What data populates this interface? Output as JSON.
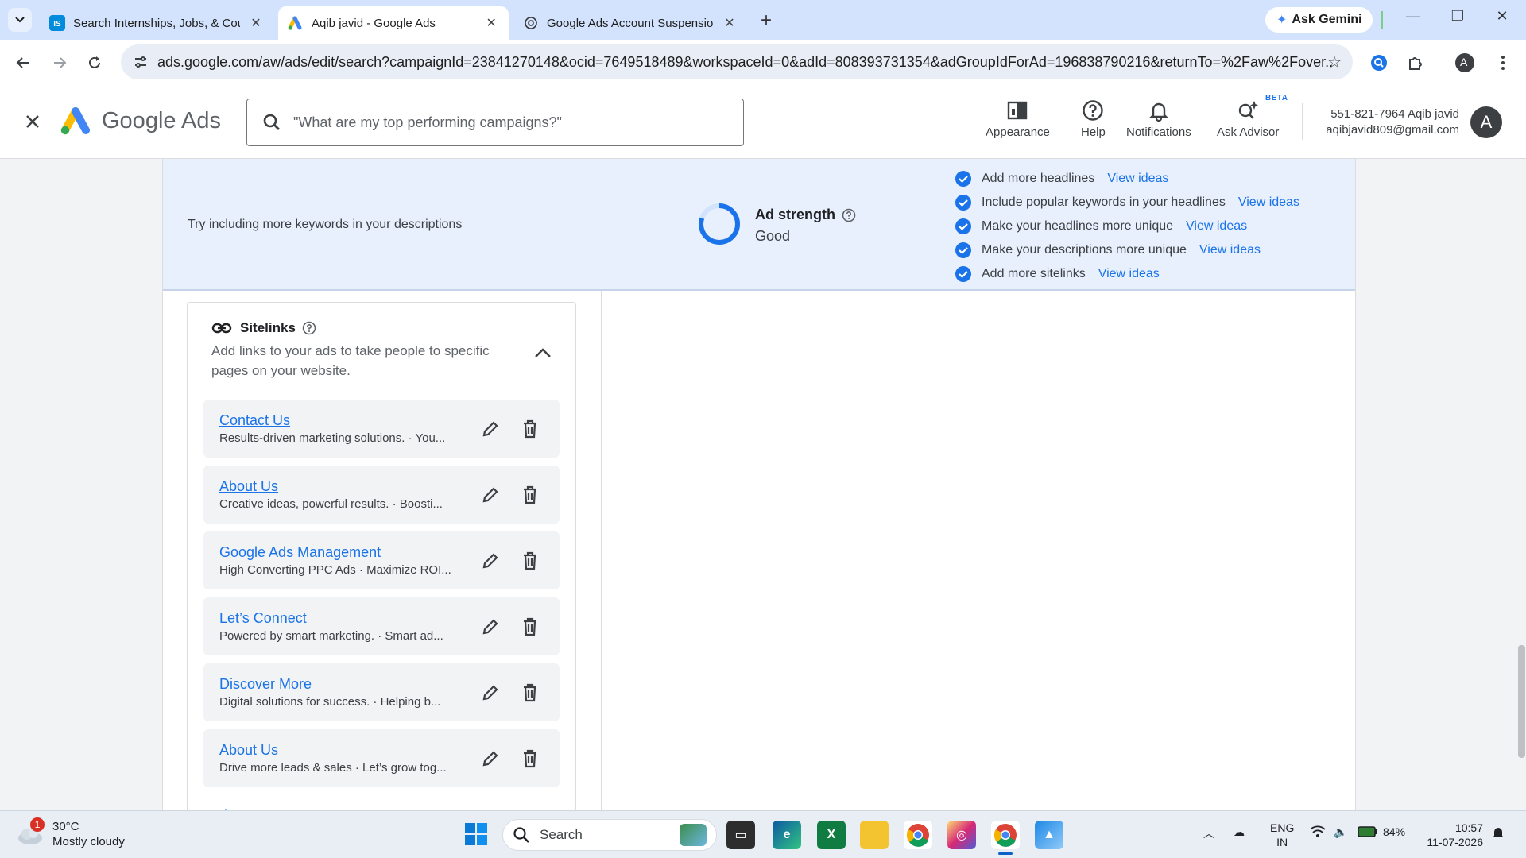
{
  "browser": {
    "tabs": [
      {
        "title": "Search Internships, Jobs, & Cou",
        "favicon": "internshala-icon",
        "active": false
      },
      {
        "title": "Aqib javid - Google Ads",
        "favicon": "google-ads-icon",
        "active": true
      },
      {
        "title": "Google Ads Account Suspensio",
        "favicon": "openai-icon",
        "active": false
      }
    ],
    "gemini_label": "Ask Gemini",
    "url": "ads.google.com/aw/ads/edit/search?campaignId=23841270148&ocid=7649518489&workspaceId=0&adId=808393731354&adGroupIdForAd=196838790216&returnTo=%2Faw%2Fover...",
    "profile_initial": "A"
  },
  "ads_header": {
    "brand": "Google Ads",
    "search_placeholder": "\"What are my top performing campaigns?\"",
    "items": [
      {
        "label": "Appearance",
        "icon": "appearance-icon"
      },
      {
        "label": "Help",
        "icon": "help-icon"
      },
      {
        "label": "Notifications",
        "icon": "bell-icon"
      },
      {
        "label": "Ask Advisor",
        "icon": "advisor-icon"
      }
    ],
    "beta_label": "BETA",
    "account_line1": "551-821-7964 Aqib javid",
    "account_line2": "aqibjavid809@gmail.com",
    "avatar_initial": "A"
  },
  "ad_strength": {
    "tip": "Try including more keywords in your descriptions",
    "title": "Ad strength",
    "value": "Good",
    "progress": 0.8,
    "checklist": [
      {
        "text": "Add more headlines",
        "link": "View ideas"
      },
      {
        "text": "Include popular keywords in your headlines",
        "link": "View ideas"
      },
      {
        "text": "Make your headlines more unique",
        "link": "View ideas"
      },
      {
        "text": "Make your descriptions more unique",
        "link": "View ideas"
      },
      {
        "text": "Add more sitelinks",
        "link": "View ideas"
      }
    ]
  },
  "sitelinks": {
    "title": "Sitelinks",
    "description": "Add links to your ads to take people to specific pages on your website.",
    "items": [
      {
        "title": "Contact Us",
        "desc": "Results-driven marketing solutions. · You..."
      },
      {
        "title": "About Us",
        "desc": "Creative ideas, powerful results. · Boosti..."
      },
      {
        "title": "Google Ads Management",
        "desc": "High Converting PPC Ads · Maximize ROI..."
      },
      {
        "title": "Let’s Connect",
        "desc": "Powered by smart marketing. · Smart ad..."
      },
      {
        "title": "Discover More",
        "desc": "Digital solutions for success. · Helping b..."
      },
      {
        "title": "About Us",
        "desc": "Drive more leads & sales · Let’s grow tog..."
      }
    ]
  },
  "taskbar": {
    "weather_temp": "30°C",
    "weather_desc": "Mostly cloudy",
    "weather_badge": "1",
    "search_label": "Search",
    "lang_line1": "ENG",
    "lang_line2": "IN",
    "battery": "84%",
    "time": "10:57",
    "date": "11-07-2026"
  }
}
